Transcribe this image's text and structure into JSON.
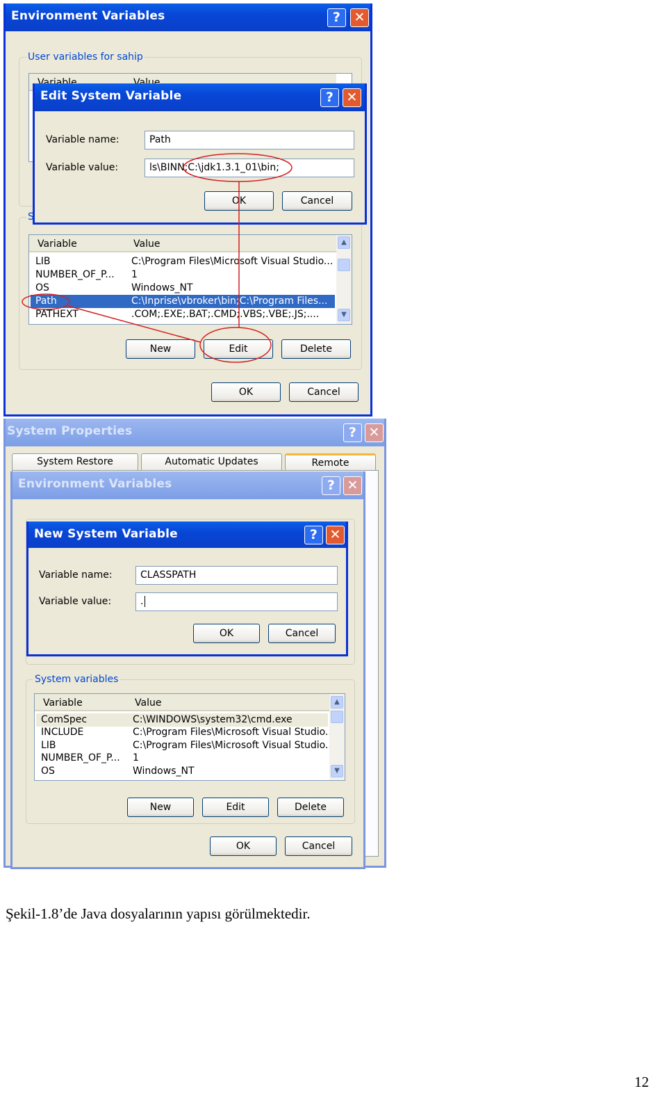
{
  "top_shot": {
    "env_window": {
      "title": "Environment Variables",
      "user_group": "User variables for sahip",
      "user_list_headers": [
        "Variable",
        "Value"
      ],
      "system_group": "Sy",
      "system_list_headers": [
        "Variable",
        "Value"
      ],
      "system_rows": [
        [
          "LIB",
          "C:\\Program Files\\Microsoft Visual Studio..."
        ],
        [
          "NUMBER_OF_P...",
          "1"
        ],
        [
          "OS",
          "Windows_NT"
        ],
        [
          "Path",
          "C:\\Inprise\\vbroker\\bin;C:\\Program Files..."
        ],
        [
          "PATHEXT",
          ".COM;.EXE;.BAT;.CMD;.VBS;.VBE;.JS;...."
        ]
      ],
      "selected_row": "Path",
      "new": "New",
      "edit": "Edit",
      "delete": "Delete",
      "ok": "OK",
      "cancel": "Cancel"
    },
    "edit_dialog": {
      "title": "Edit System Variable",
      "name_label": "Variable name:",
      "value_label": "Variable value:",
      "name_value": "Path",
      "value_value": "ls\\BINN;C:\\jdk1.3.1_01\\bin;",
      "ok": "OK",
      "cancel": "Cancel"
    },
    "annotation_color": "#d42020"
  },
  "bottom_shot": {
    "sysprop_window": {
      "title": "System Properties",
      "tabs": [
        "System Restore",
        "Automatic Updates",
        "Remote"
      ]
    },
    "env_window": {
      "title": "Environment Variables",
      "system_group": "System variables",
      "list_headers": [
        "Variable",
        "Value"
      ],
      "rows": [
        [
          "ComSpec",
          "C:\\WINDOWS\\system32\\cmd.exe"
        ],
        [
          "INCLUDE",
          "C:\\Program Files\\Microsoft Visual Studio..."
        ],
        [
          "LIB",
          "C:\\Program Files\\Microsoft Visual Studio..."
        ],
        [
          "NUMBER_OF_P...",
          "1"
        ],
        [
          "OS",
          "Windows_NT"
        ]
      ],
      "new": "New",
      "edit": "Edit",
      "delete": "Delete",
      "ok": "OK",
      "cancel": "Cancel"
    },
    "new_dialog": {
      "title": "New System Variable",
      "name_label": "Variable name:",
      "value_label": "Variable value:",
      "name_value": "CLASSPATH",
      "value_value": ".",
      "ok": "OK",
      "cancel": "Cancel"
    }
  },
  "caption": "Şekil-1.8’de Java dosyalarının yapısı görülmektedir.",
  "page_number": "12"
}
